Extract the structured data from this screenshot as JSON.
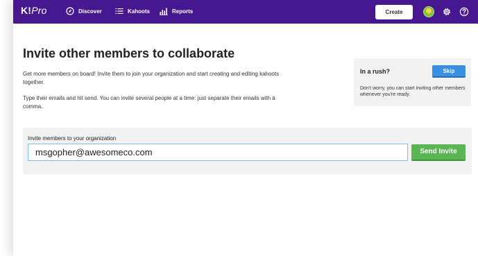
{
  "nav": {
    "logo_k": "K!",
    "logo_pro": "Pro",
    "discover_label": "Discover",
    "discover_icon": "compass-icon",
    "kahoots_label": "Kahoots",
    "kahoots_icon": "list-icon",
    "reports_label": "Reports",
    "reports_icon": "bar-chart-icon",
    "create_label": "Create",
    "settings_icon": "gear-icon",
    "help_icon": "help-icon"
  },
  "main": {
    "title": "Invite other members to collaborate",
    "intro": "Get more members on board! Invite them to join your organization and start creating and editing kahoots together.",
    "instructions": "Type their emails and hit send. You can invite several people at a time: just separate their emails with a comma."
  },
  "rush": {
    "title": "In a rush?",
    "skip_label": "Skip",
    "text": "Don't worry, you can start inviting other members whenever you're ready."
  },
  "invite": {
    "label": "Invite members to your organization",
    "value": "msgopher@awesomeco.com",
    "send_label": "Send Invite"
  },
  "colors": {
    "nav_bg": "#46178f",
    "skip_button": "#3b8fe0",
    "send_button": "#5ab552"
  }
}
